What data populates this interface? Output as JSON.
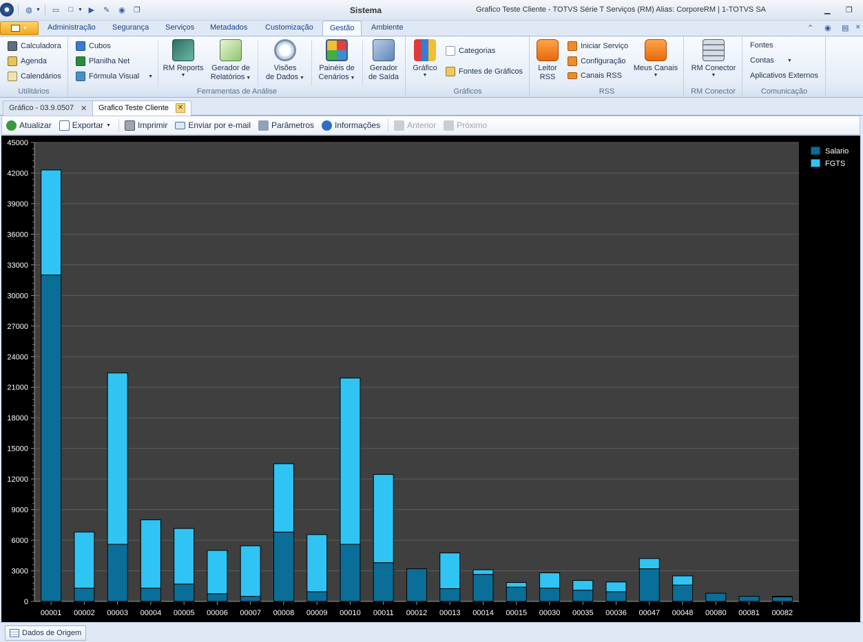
{
  "titlebar": {
    "app_title": "Sistema",
    "window_title": "Grafico Teste Cliente - TOTVS Série T Serviços (RM) Alias: CorporeRM | 1-TOTVS SA"
  },
  "ribbon": {
    "tabs": [
      "Administração",
      "Segurança",
      "Serviços",
      "Metadados",
      "Customização",
      "Gestão",
      "Ambiente"
    ],
    "active_tab": "Gestão",
    "groups": {
      "utilitarios": {
        "label": "Utilitários",
        "items": [
          "Calculadora",
          "Agenda",
          "Calendários"
        ]
      },
      "ferramentas": {
        "label": "Ferramentas de Análise",
        "small_items": [
          "Cubos",
          "Planilha Net",
          "Fórmula Visual"
        ],
        "rm_reports": "RM Reports",
        "gerador_1": "Gerador de",
        "gerador_2": "Relatórios",
        "visoes_1": "Visões",
        "visoes_2": "de Dados",
        "paineis_1": "Painéis de",
        "paineis_2": "Cenários",
        "saida_1": "Gerador",
        "saida_2": "de Saída"
      },
      "graficos": {
        "label": "Gráficos",
        "grafico": "Gráfico",
        "categorias": "Categorias",
        "fontes": "Fontes de Gráficos"
      },
      "rss": {
        "label": "RSS",
        "leitor_1": "Leitor",
        "leitor_2": "RSS",
        "items": [
          "Iniciar Serviço",
          "Configuração",
          "Canais RSS"
        ],
        "meus_canais": "Meus Canais"
      },
      "rmconector": {
        "label": "RM Conector",
        "button": "RM Conector"
      },
      "comunicacao": {
        "label": "Comunicação",
        "items": [
          "Fontes",
          "Contas",
          "Aplicativos Externos"
        ]
      }
    }
  },
  "doc_tabs": [
    {
      "label": "Gráfico - 03.9.0507",
      "active": false
    },
    {
      "label": "Grafico Teste Cliente",
      "active": true
    }
  ],
  "toolbar": {
    "atualizar": "Atualizar",
    "exportar": "Exportar",
    "imprimir": "Imprimir",
    "email": "Enviar por e-mail",
    "parametros": "Parâmetros",
    "informacoes": "Informações",
    "anterior": "Anterior",
    "proximo": "Próximo"
  },
  "colors": {
    "salario": "#0a6e98",
    "fgts": "#30c4f4",
    "plot_bg": "#3f3f3f",
    "chart_bg": "#000000"
  },
  "chart_data": {
    "type": "bar",
    "stacked": true,
    "categories": [
      "00001",
      "00002",
      "00003",
      "00004",
      "00005",
      "00006",
      "00007",
      "00008",
      "00009",
      "00010",
      "00011",
      "00012",
      "00013",
      "00014",
      "00015",
      "00030",
      "00035",
      "00036",
      "00047",
      "00048",
      "00080",
      "00081",
      "00082"
    ],
    "series": [
      {
        "name": "Salario",
        "values": [
          32000,
          1300,
          5600,
          1300,
          1700,
          750,
          500,
          6800,
          950,
          5600,
          3800,
          3200,
          1250,
          2650,
          1400,
          1300,
          1100,
          950,
          3200,
          1600,
          800,
          500,
          450
        ]
      },
      {
        "name": "FGTS",
        "values": [
          10300,
          5500,
          16800,
          6700,
          5450,
          4250,
          4950,
          6700,
          5600,
          16300,
          8650,
          0,
          3500,
          450,
          450,
          1500,
          950,
          950,
          1000,
          900,
          0,
          0,
          50
        ]
      }
    ],
    "yticks": [
      0,
      3000,
      6000,
      9000,
      12000,
      15000,
      18000,
      21000,
      24000,
      27000,
      30000,
      33000,
      36000,
      39000,
      42000,
      45000
    ],
    "ylim": [
      0,
      45000
    ],
    "legend_position": "right",
    "grid": true
  },
  "statusbar": {
    "dados_origem": "Dados de Origem"
  }
}
